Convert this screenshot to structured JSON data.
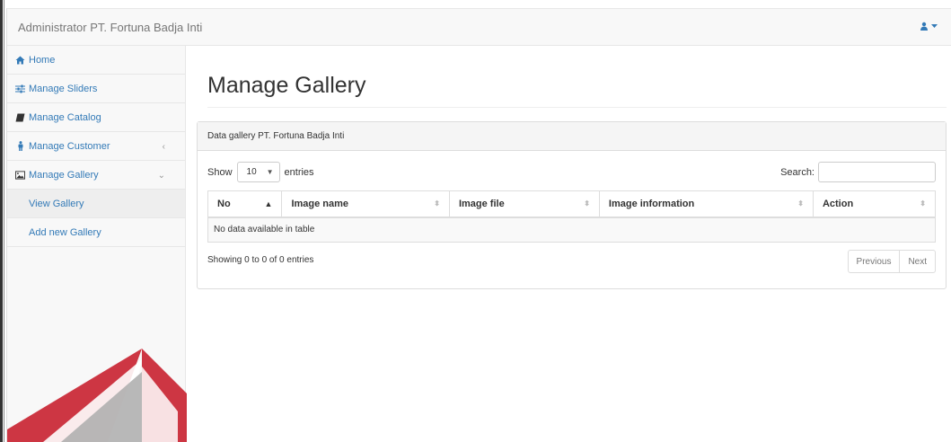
{
  "navbar": {
    "brand": "Administrator PT. Fortuna Badja Inti",
    "user_icon": "user-icon",
    "caret_icon": "caret-down-icon"
  },
  "sidebar": {
    "items": [
      {
        "label": "Home",
        "icon": "home-icon"
      },
      {
        "label": "Manage Sliders",
        "icon": "sliders-icon"
      },
      {
        "label": "Manage Catalog",
        "icon": "book-icon"
      },
      {
        "label": "Manage Customer",
        "icon": "male-icon",
        "chevron": "‹"
      },
      {
        "label": "Manage Gallery",
        "icon": "picture-icon",
        "chevron": "⌄"
      }
    ],
    "subitems": [
      {
        "label": "View Gallery"
      },
      {
        "label": "Add new Gallery"
      }
    ]
  },
  "main": {
    "title": "Manage Gallery",
    "panel_heading": "Data gallery PT. Fortuna Badja Inti",
    "show_label": "Show",
    "entries_value": "10",
    "entries_label": "entries",
    "search_label": "Search:",
    "search_value": "",
    "columns": [
      {
        "label": "No"
      },
      {
        "label": "Image name"
      },
      {
        "label": "Image file"
      },
      {
        "label": "Image information"
      },
      {
        "label": "Action"
      }
    ],
    "empty_message": "No data available in table",
    "info": "Showing 0 to 0 of 0 entries",
    "prev_label": "Previous",
    "next_label": "Next"
  },
  "colors": {
    "link": "#337ab7",
    "navbar_bg": "#f8f8f8",
    "border": "#dddddd",
    "watermark_red": "#c8202f"
  }
}
